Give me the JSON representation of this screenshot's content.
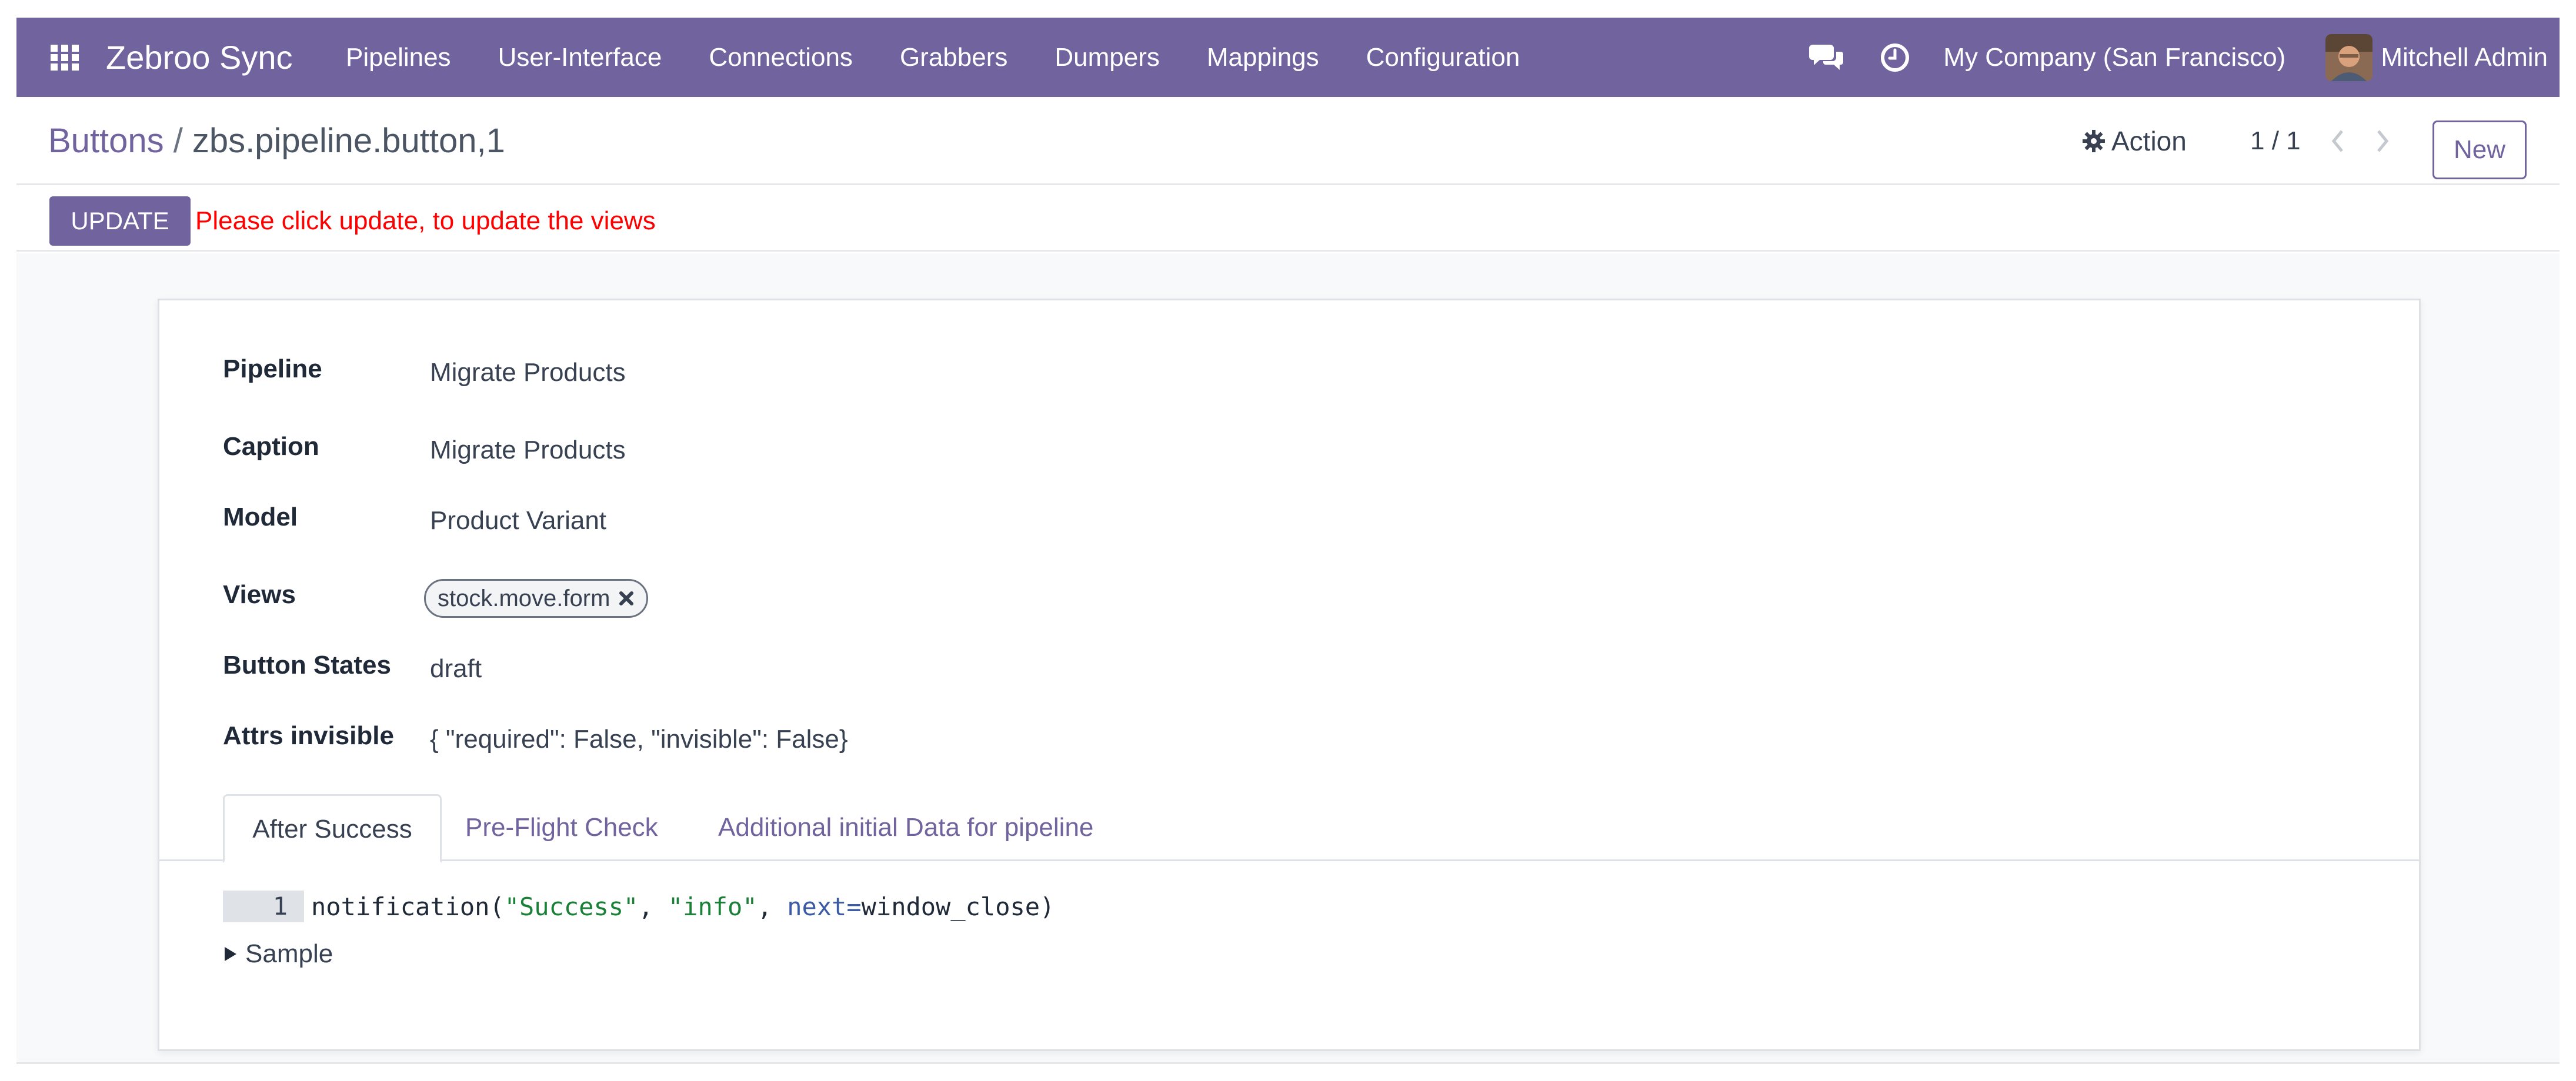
{
  "navbar": {
    "brand": "Zebroo Sync",
    "menu": [
      "Pipelines",
      "User-Interface",
      "Connections",
      "Grabbers",
      "Dumpers",
      "Mappings",
      "Configuration"
    ],
    "company": "My Company (San Francisco)",
    "user": "Mitchell Admin",
    "icons": [
      "apps-grid-icon",
      "chat-icon",
      "clock-icon"
    ],
    "bg_color": "#71639e"
  },
  "control": {
    "breadcrumb_parent": "Buttons",
    "breadcrumb_sep": "/",
    "breadcrumb_current": "zbs.pipeline.button,1",
    "action_label": "Action",
    "pager": "1 / 1",
    "new_label": "New"
  },
  "statusbar": {
    "update_label": "UPDATE",
    "update_message": "Please click update, to update the views",
    "message_color": "#ff0000"
  },
  "form": {
    "fields": [
      {
        "label": "Pipeline",
        "value": "Migrate Products"
      },
      {
        "label": "Caption",
        "value": "Migrate Products"
      },
      {
        "label": "Model",
        "value": "Product Variant"
      },
      {
        "label": "Views",
        "value": ""
      },
      {
        "label": "Button States",
        "value": "draft"
      },
      {
        "label": "Attrs invisible",
        "value": "{ \"required\": False, \"invisible\": False}"
      }
    ],
    "views_tag": "stock.move.form",
    "tabs": [
      "After Success",
      "Pre-Flight Check",
      "Additional initial Data for pipeline"
    ],
    "active_tab": "After Success",
    "code": {
      "line_number": "1",
      "fn": "notification(",
      "str1": "\"Success\"",
      "sep1": ", ",
      "str2": "\"info\"",
      "sep2": ", ",
      "kw": "next=",
      "rest": "window_close)"
    },
    "sample_label": "Sample"
  }
}
